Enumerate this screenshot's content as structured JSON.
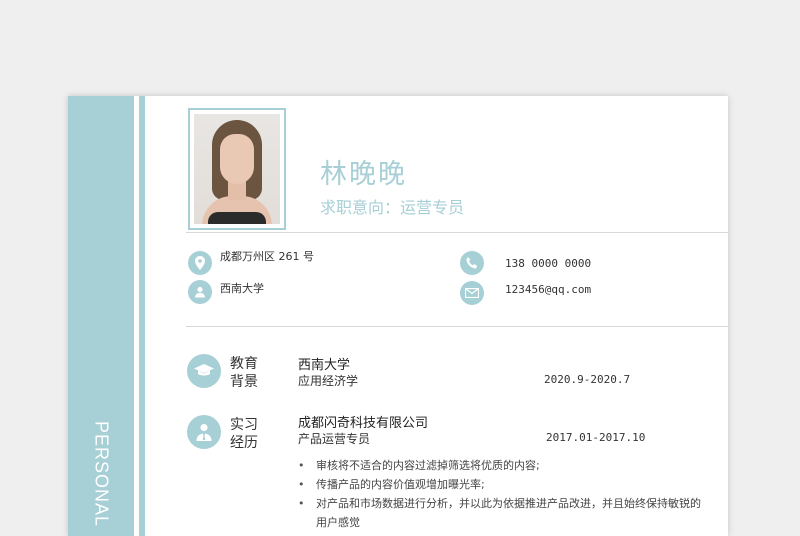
{
  "sidebar": {
    "vertical_text": "PERSONAL"
  },
  "header": {
    "name": "林晚晚",
    "job_intent": "求职意向：运营专员"
  },
  "contact": {
    "address": "成都万州区 261 号",
    "school": "西南大学",
    "phone": "138 0000 0000",
    "email": "123456@qq.com"
  },
  "education": {
    "title": "教育背景",
    "school": "西南大学",
    "major": "应用经济学",
    "date": "2020.9-2020.7"
  },
  "internship": {
    "title": "实习经历",
    "company": "成都闪奇科技有限公司",
    "role": "产品运营专员",
    "date": "2017.01-2017.10",
    "duties": [
      "审核将不适合的内容过滤掉筛选将优质的内容;",
      "传播产品的内容价值观增加曝光率;",
      "对产品和市场数据进行分析，并以此为依据推进产品改进，并且始终保持敏锐的用户感觉"
    ]
  },
  "colors": {
    "accent": "#a7cfd6",
    "background": "#efefef",
    "paper": "#ffffff"
  },
  "icons": [
    "location-pin-icon",
    "user-icon",
    "phone-icon",
    "mail-icon",
    "graduation-cap-icon",
    "person-tie-icon"
  ]
}
